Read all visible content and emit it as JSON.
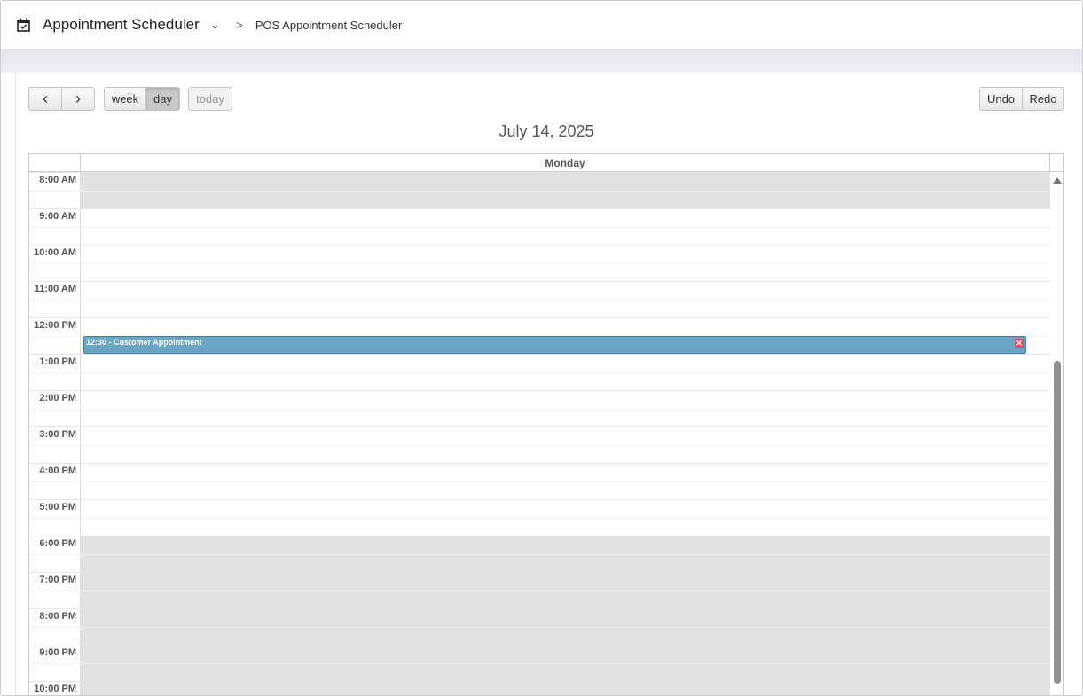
{
  "header": {
    "app_title": "Appointment Scheduler",
    "breadcrumb": "POS Appointment Scheduler"
  },
  "toolbar": {
    "prev": "‹",
    "next": "›",
    "week": "week",
    "day": "day",
    "today": "today",
    "undo": "Undo",
    "redo": "Redo",
    "active_view": "day"
  },
  "calendar": {
    "title": "July 14, 2025",
    "day_header": "Monday",
    "hours": [
      "8:00 AM",
      "9:00 AM",
      "10:00 AM",
      "11:00 AM",
      "12:00 PM",
      "1:00 PM",
      "2:00 PM",
      "3:00 PM",
      "4:00 PM",
      "5:00 PM",
      "6:00 PM",
      "7:00 PM",
      "8:00 PM",
      "9:00 PM",
      "10:00 PM"
    ],
    "off_hours": [
      "8:00 AM",
      "6:00 PM",
      "7:00 PM",
      "8:00 PM",
      "9:00 PM",
      "10:00 PM"
    ],
    "events": [
      {
        "time": "12:30",
        "title": "Customer Appointment",
        "label": "12:30 - Customer Appointment",
        "start_hour": 12.5,
        "duration_hours": 0.5,
        "color": "#6aa5c4"
      }
    ]
  }
}
